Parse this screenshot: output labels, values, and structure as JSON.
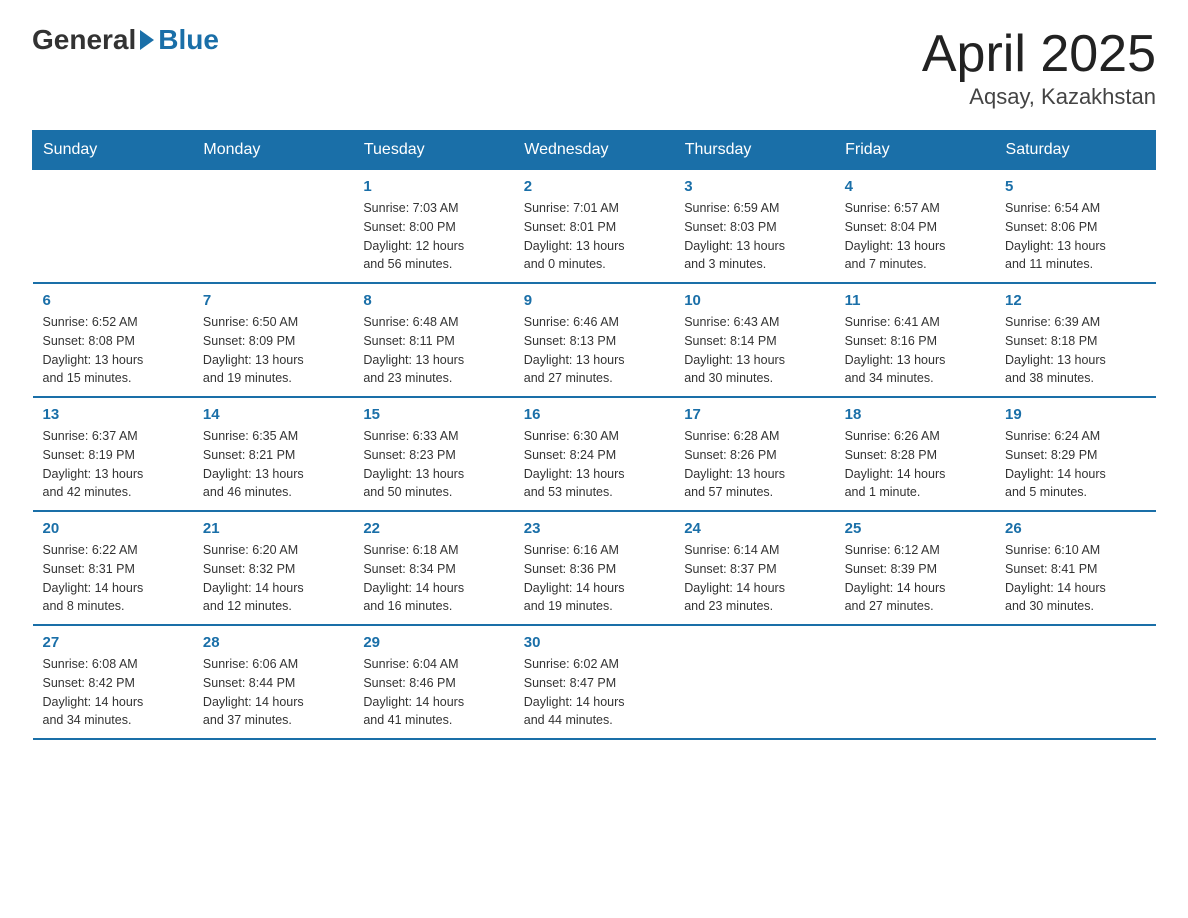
{
  "logo": {
    "general": "General",
    "blue": "Blue"
  },
  "title": "April 2025",
  "location": "Aqsay, Kazakhstan",
  "days_header": [
    "Sunday",
    "Monday",
    "Tuesday",
    "Wednesday",
    "Thursday",
    "Friday",
    "Saturday"
  ],
  "weeks": [
    [
      {
        "day": "",
        "info": ""
      },
      {
        "day": "",
        "info": ""
      },
      {
        "day": "1",
        "info": "Sunrise: 7:03 AM\nSunset: 8:00 PM\nDaylight: 12 hours\nand 56 minutes."
      },
      {
        "day": "2",
        "info": "Sunrise: 7:01 AM\nSunset: 8:01 PM\nDaylight: 13 hours\nand 0 minutes."
      },
      {
        "day": "3",
        "info": "Sunrise: 6:59 AM\nSunset: 8:03 PM\nDaylight: 13 hours\nand 3 minutes."
      },
      {
        "day": "4",
        "info": "Sunrise: 6:57 AM\nSunset: 8:04 PM\nDaylight: 13 hours\nand 7 minutes."
      },
      {
        "day": "5",
        "info": "Sunrise: 6:54 AM\nSunset: 8:06 PM\nDaylight: 13 hours\nand 11 minutes."
      }
    ],
    [
      {
        "day": "6",
        "info": "Sunrise: 6:52 AM\nSunset: 8:08 PM\nDaylight: 13 hours\nand 15 minutes."
      },
      {
        "day": "7",
        "info": "Sunrise: 6:50 AM\nSunset: 8:09 PM\nDaylight: 13 hours\nand 19 minutes."
      },
      {
        "day": "8",
        "info": "Sunrise: 6:48 AM\nSunset: 8:11 PM\nDaylight: 13 hours\nand 23 minutes."
      },
      {
        "day": "9",
        "info": "Sunrise: 6:46 AM\nSunset: 8:13 PM\nDaylight: 13 hours\nand 27 minutes."
      },
      {
        "day": "10",
        "info": "Sunrise: 6:43 AM\nSunset: 8:14 PM\nDaylight: 13 hours\nand 30 minutes."
      },
      {
        "day": "11",
        "info": "Sunrise: 6:41 AM\nSunset: 8:16 PM\nDaylight: 13 hours\nand 34 minutes."
      },
      {
        "day": "12",
        "info": "Sunrise: 6:39 AM\nSunset: 8:18 PM\nDaylight: 13 hours\nand 38 minutes."
      }
    ],
    [
      {
        "day": "13",
        "info": "Sunrise: 6:37 AM\nSunset: 8:19 PM\nDaylight: 13 hours\nand 42 minutes."
      },
      {
        "day": "14",
        "info": "Sunrise: 6:35 AM\nSunset: 8:21 PM\nDaylight: 13 hours\nand 46 minutes."
      },
      {
        "day": "15",
        "info": "Sunrise: 6:33 AM\nSunset: 8:23 PM\nDaylight: 13 hours\nand 50 minutes."
      },
      {
        "day": "16",
        "info": "Sunrise: 6:30 AM\nSunset: 8:24 PM\nDaylight: 13 hours\nand 53 minutes."
      },
      {
        "day": "17",
        "info": "Sunrise: 6:28 AM\nSunset: 8:26 PM\nDaylight: 13 hours\nand 57 minutes."
      },
      {
        "day": "18",
        "info": "Sunrise: 6:26 AM\nSunset: 8:28 PM\nDaylight: 14 hours\nand 1 minute."
      },
      {
        "day": "19",
        "info": "Sunrise: 6:24 AM\nSunset: 8:29 PM\nDaylight: 14 hours\nand 5 minutes."
      }
    ],
    [
      {
        "day": "20",
        "info": "Sunrise: 6:22 AM\nSunset: 8:31 PM\nDaylight: 14 hours\nand 8 minutes."
      },
      {
        "day": "21",
        "info": "Sunrise: 6:20 AM\nSunset: 8:32 PM\nDaylight: 14 hours\nand 12 minutes."
      },
      {
        "day": "22",
        "info": "Sunrise: 6:18 AM\nSunset: 8:34 PM\nDaylight: 14 hours\nand 16 minutes."
      },
      {
        "day": "23",
        "info": "Sunrise: 6:16 AM\nSunset: 8:36 PM\nDaylight: 14 hours\nand 19 minutes."
      },
      {
        "day": "24",
        "info": "Sunrise: 6:14 AM\nSunset: 8:37 PM\nDaylight: 14 hours\nand 23 minutes."
      },
      {
        "day": "25",
        "info": "Sunrise: 6:12 AM\nSunset: 8:39 PM\nDaylight: 14 hours\nand 27 minutes."
      },
      {
        "day": "26",
        "info": "Sunrise: 6:10 AM\nSunset: 8:41 PM\nDaylight: 14 hours\nand 30 minutes."
      }
    ],
    [
      {
        "day": "27",
        "info": "Sunrise: 6:08 AM\nSunset: 8:42 PM\nDaylight: 14 hours\nand 34 minutes."
      },
      {
        "day": "28",
        "info": "Sunrise: 6:06 AM\nSunset: 8:44 PM\nDaylight: 14 hours\nand 37 minutes."
      },
      {
        "day": "29",
        "info": "Sunrise: 6:04 AM\nSunset: 8:46 PM\nDaylight: 14 hours\nand 41 minutes."
      },
      {
        "day": "30",
        "info": "Sunrise: 6:02 AM\nSunset: 8:47 PM\nDaylight: 14 hours\nand 44 minutes."
      },
      {
        "day": "",
        "info": ""
      },
      {
        "day": "",
        "info": ""
      },
      {
        "day": "",
        "info": ""
      }
    ]
  ]
}
